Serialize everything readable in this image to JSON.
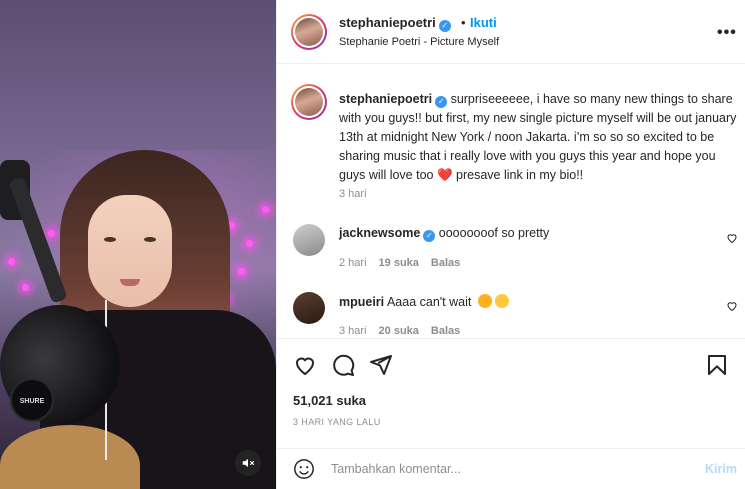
{
  "post": {
    "username": "stephaniepoetri",
    "dot": "•",
    "follow_label": "Ikuti",
    "audio_label": "Stephanie Poetri - Picture Myself",
    "more_label": "•••"
  },
  "caption": {
    "username": "stephaniepoetri",
    "text": "surpriseeeeee, i have so many new things to share with you guys!! but first, my new single picture myself will be out january 13th at midnight New York / noon Jakarta. i’m so so so excited to be sharing music that i really love with you guys this year and hope you guys will love too ❤️ presave link in my bio!!",
    "time": "3 hari"
  },
  "comments": [
    {
      "username": "jacknewsome",
      "verified": true,
      "text": "oooooooof so pretty",
      "time": "2 hari",
      "likes": "19 suka",
      "reply": "Balas"
    },
    {
      "username": "mpueiri",
      "verified": false,
      "text": "Aaaa can't wait",
      "time": "3 hari",
      "likes": "20 suka",
      "reply": "Balas"
    }
  ],
  "stats": {
    "likes": "51,021 suka",
    "posted": "3 HARI YANG LALU"
  },
  "composer": {
    "placeholder": "Tambahkan komentar...",
    "post_label": "Kirim"
  },
  "media": {
    "mic_badge": "SHURE"
  },
  "colors": {
    "accent": "#0095f6",
    "verified": "#3897f0",
    "post_disabled": "#b3dbff",
    "muted": "#8e8e8e"
  }
}
